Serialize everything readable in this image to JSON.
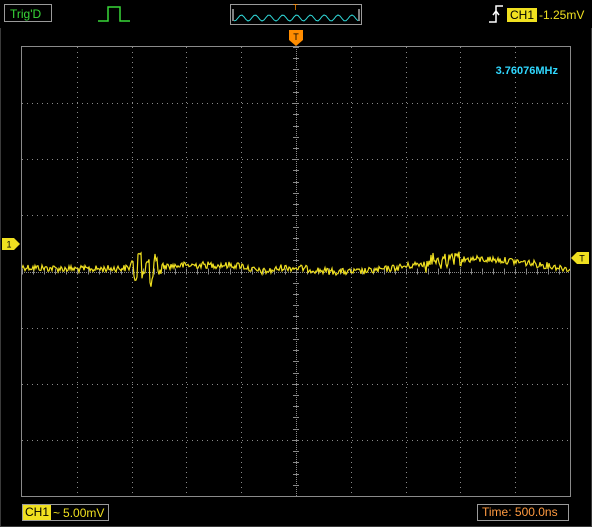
{
  "status": {
    "trigger_state": "Trig'D",
    "trigger_source": "CH1",
    "trigger_level": "-1.25mV",
    "timebase_window_marker": "T"
  },
  "markers": {
    "horizontal_trigger": "T",
    "channel": "1",
    "trigger_level": "T"
  },
  "measurement": {
    "frequency": "3.76076MHz"
  },
  "channel1": {
    "label": "CH1",
    "coupling": "~",
    "volts_per_div": "5.00mV"
  },
  "timebase": {
    "time_per_div": "Time: 500.0ns"
  },
  "colors": {
    "trace": "#f0e020",
    "grid": "#8a8a8a",
    "freq": "#30d8ff",
    "trig_ok": "#38d838",
    "time": "#ff9a40",
    "marker_orange": "#ff8c00"
  }
}
